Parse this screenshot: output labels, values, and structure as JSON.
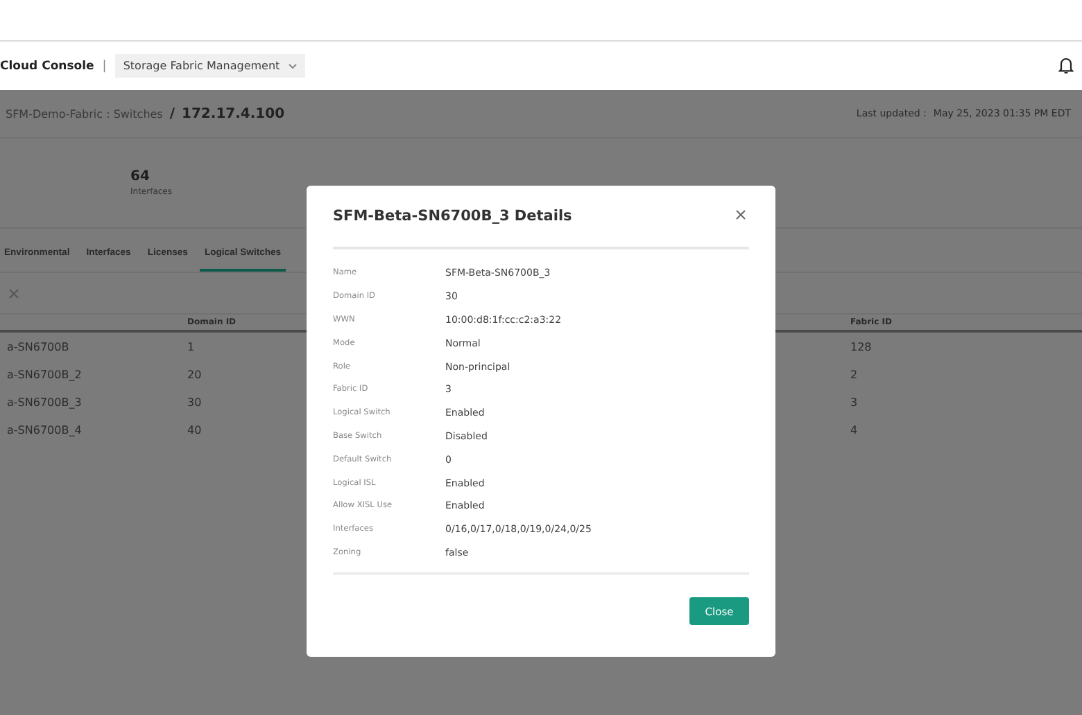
{
  "header": {
    "brand": "Cloud Console",
    "separator": "|",
    "app_menu": "Storage Fabric Management"
  },
  "breadcrumb": {
    "parent": "SFM-Demo-Fabric : Switches",
    "divider": "/",
    "current": "172.17.4.100"
  },
  "last_updated": {
    "label": "Last updated :",
    "value": "May 25, 2023 01:35 PM EDT"
  },
  "stats": [
    {
      "value": "64",
      "label": "Interfaces"
    }
  ],
  "tabs": [
    {
      "label": "Environmental",
      "selected": false
    },
    {
      "label": "Interfaces",
      "selected": false
    },
    {
      "label": "Licenses",
      "selected": false
    },
    {
      "label": "Logical Switches",
      "selected": true
    }
  ],
  "table": {
    "columns": [
      "",
      "Domain ID",
      "Fabric ID"
    ],
    "rows": [
      [
        "a-SN6700B",
        "1",
        "128"
      ],
      [
        "a-SN6700B_2",
        "20",
        "2"
      ],
      [
        "a-SN6700B_3",
        "30",
        "3"
      ],
      [
        "a-SN6700B_4",
        "40",
        "4"
      ]
    ]
  },
  "modal": {
    "title": "SFM-Beta-SN6700B_3 Details",
    "fields": [
      {
        "label": "Name",
        "value": "SFM-Beta-SN6700B_3"
      },
      {
        "label": "Domain ID",
        "value": "30"
      },
      {
        "label": "WWN",
        "value": "10:00:d8:1f:cc:c2:a3:22"
      },
      {
        "label": "Mode",
        "value": "Normal"
      },
      {
        "label": "Role",
        "value": "Non-principal"
      },
      {
        "label": "Fabric ID",
        "value": "3"
      },
      {
        "label": "Logical Switch",
        "value": "Enabled"
      },
      {
        "label": "Base Switch",
        "value": "Disabled"
      },
      {
        "label": "Default Switch",
        "value": "0"
      },
      {
        "label": "Logical ISL",
        "value": "Enabled"
      },
      {
        "label": "Allow XISL Use",
        "value": "Enabled"
      },
      {
        "label": "Interfaces",
        "value": "0/16,0/17,0/18,0/19,0/24,0/25"
      },
      {
        "label": "Zoning",
        "value": "false"
      }
    ],
    "button": "Close"
  }
}
